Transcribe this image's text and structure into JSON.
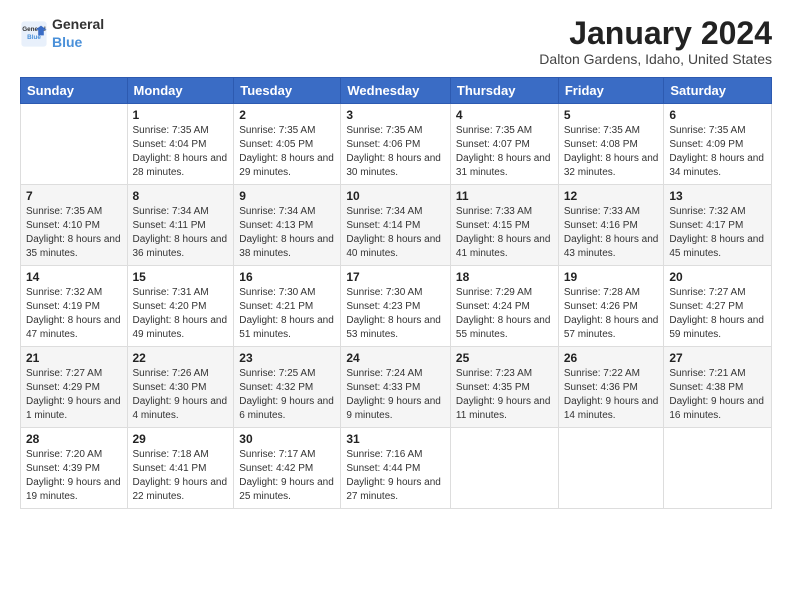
{
  "logo": {
    "general": "General",
    "blue": "Blue"
  },
  "title": "January 2024",
  "location": "Dalton Gardens, Idaho, United States",
  "days_header": [
    "Sunday",
    "Monday",
    "Tuesday",
    "Wednesday",
    "Thursday",
    "Friday",
    "Saturday"
  ],
  "weeks": [
    [
      {
        "num": "",
        "sunrise": "",
        "sunset": "",
        "daylight": ""
      },
      {
        "num": "1",
        "sunrise": "Sunrise: 7:35 AM",
        "sunset": "Sunset: 4:04 PM",
        "daylight": "Daylight: 8 hours and 28 minutes."
      },
      {
        "num": "2",
        "sunrise": "Sunrise: 7:35 AM",
        "sunset": "Sunset: 4:05 PM",
        "daylight": "Daylight: 8 hours and 29 minutes."
      },
      {
        "num": "3",
        "sunrise": "Sunrise: 7:35 AM",
        "sunset": "Sunset: 4:06 PM",
        "daylight": "Daylight: 8 hours and 30 minutes."
      },
      {
        "num": "4",
        "sunrise": "Sunrise: 7:35 AM",
        "sunset": "Sunset: 4:07 PM",
        "daylight": "Daylight: 8 hours and 31 minutes."
      },
      {
        "num": "5",
        "sunrise": "Sunrise: 7:35 AM",
        "sunset": "Sunset: 4:08 PM",
        "daylight": "Daylight: 8 hours and 32 minutes."
      },
      {
        "num": "6",
        "sunrise": "Sunrise: 7:35 AM",
        "sunset": "Sunset: 4:09 PM",
        "daylight": "Daylight: 8 hours and 34 minutes."
      }
    ],
    [
      {
        "num": "7",
        "sunrise": "Sunrise: 7:35 AM",
        "sunset": "Sunset: 4:10 PM",
        "daylight": "Daylight: 8 hours and 35 minutes."
      },
      {
        "num": "8",
        "sunrise": "Sunrise: 7:34 AM",
        "sunset": "Sunset: 4:11 PM",
        "daylight": "Daylight: 8 hours and 36 minutes."
      },
      {
        "num": "9",
        "sunrise": "Sunrise: 7:34 AM",
        "sunset": "Sunset: 4:13 PM",
        "daylight": "Daylight: 8 hours and 38 minutes."
      },
      {
        "num": "10",
        "sunrise": "Sunrise: 7:34 AM",
        "sunset": "Sunset: 4:14 PM",
        "daylight": "Daylight: 8 hours and 40 minutes."
      },
      {
        "num": "11",
        "sunrise": "Sunrise: 7:33 AM",
        "sunset": "Sunset: 4:15 PM",
        "daylight": "Daylight: 8 hours and 41 minutes."
      },
      {
        "num": "12",
        "sunrise": "Sunrise: 7:33 AM",
        "sunset": "Sunset: 4:16 PM",
        "daylight": "Daylight: 8 hours and 43 minutes."
      },
      {
        "num": "13",
        "sunrise": "Sunrise: 7:32 AM",
        "sunset": "Sunset: 4:17 PM",
        "daylight": "Daylight: 8 hours and 45 minutes."
      }
    ],
    [
      {
        "num": "14",
        "sunrise": "Sunrise: 7:32 AM",
        "sunset": "Sunset: 4:19 PM",
        "daylight": "Daylight: 8 hours and 47 minutes."
      },
      {
        "num": "15",
        "sunrise": "Sunrise: 7:31 AM",
        "sunset": "Sunset: 4:20 PM",
        "daylight": "Daylight: 8 hours and 49 minutes."
      },
      {
        "num": "16",
        "sunrise": "Sunrise: 7:30 AM",
        "sunset": "Sunset: 4:21 PM",
        "daylight": "Daylight: 8 hours and 51 minutes."
      },
      {
        "num": "17",
        "sunrise": "Sunrise: 7:30 AM",
        "sunset": "Sunset: 4:23 PM",
        "daylight": "Daylight: 8 hours and 53 minutes."
      },
      {
        "num": "18",
        "sunrise": "Sunrise: 7:29 AM",
        "sunset": "Sunset: 4:24 PM",
        "daylight": "Daylight: 8 hours and 55 minutes."
      },
      {
        "num": "19",
        "sunrise": "Sunrise: 7:28 AM",
        "sunset": "Sunset: 4:26 PM",
        "daylight": "Daylight: 8 hours and 57 minutes."
      },
      {
        "num": "20",
        "sunrise": "Sunrise: 7:27 AM",
        "sunset": "Sunset: 4:27 PM",
        "daylight": "Daylight: 8 hours and 59 minutes."
      }
    ],
    [
      {
        "num": "21",
        "sunrise": "Sunrise: 7:27 AM",
        "sunset": "Sunset: 4:29 PM",
        "daylight": "Daylight: 9 hours and 1 minute."
      },
      {
        "num": "22",
        "sunrise": "Sunrise: 7:26 AM",
        "sunset": "Sunset: 4:30 PM",
        "daylight": "Daylight: 9 hours and 4 minutes."
      },
      {
        "num": "23",
        "sunrise": "Sunrise: 7:25 AM",
        "sunset": "Sunset: 4:32 PM",
        "daylight": "Daylight: 9 hours and 6 minutes."
      },
      {
        "num": "24",
        "sunrise": "Sunrise: 7:24 AM",
        "sunset": "Sunset: 4:33 PM",
        "daylight": "Daylight: 9 hours and 9 minutes."
      },
      {
        "num": "25",
        "sunrise": "Sunrise: 7:23 AM",
        "sunset": "Sunset: 4:35 PM",
        "daylight": "Daylight: 9 hours and 11 minutes."
      },
      {
        "num": "26",
        "sunrise": "Sunrise: 7:22 AM",
        "sunset": "Sunset: 4:36 PM",
        "daylight": "Daylight: 9 hours and 14 minutes."
      },
      {
        "num": "27",
        "sunrise": "Sunrise: 7:21 AM",
        "sunset": "Sunset: 4:38 PM",
        "daylight": "Daylight: 9 hours and 16 minutes."
      }
    ],
    [
      {
        "num": "28",
        "sunrise": "Sunrise: 7:20 AM",
        "sunset": "Sunset: 4:39 PM",
        "daylight": "Daylight: 9 hours and 19 minutes."
      },
      {
        "num": "29",
        "sunrise": "Sunrise: 7:18 AM",
        "sunset": "Sunset: 4:41 PM",
        "daylight": "Daylight: 9 hours and 22 minutes."
      },
      {
        "num": "30",
        "sunrise": "Sunrise: 7:17 AM",
        "sunset": "Sunset: 4:42 PM",
        "daylight": "Daylight: 9 hours and 25 minutes."
      },
      {
        "num": "31",
        "sunrise": "Sunrise: 7:16 AM",
        "sunset": "Sunset: 4:44 PM",
        "daylight": "Daylight: 9 hours and 27 minutes."
      },
      {
        "num": "",
        "sunrise": "",
        "sunset": "",
        "daylight": ""
      },
      {
        "num": "",
        "sunrise": "",
        "sunset": "",
        "daylight": ""
      },
      {
        "num": "",
        "sunrise": "",
        "sunset": "",
        "daylight": ""
      }
    ]
  ]
}
